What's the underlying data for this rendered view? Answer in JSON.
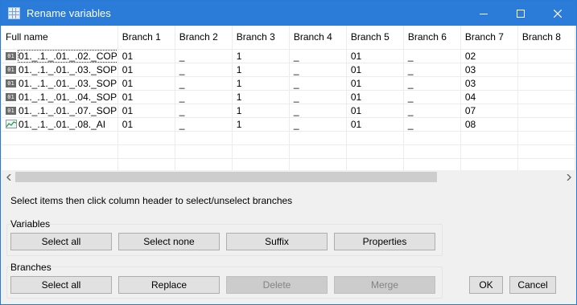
{
  "window": {
    "title": "Rename variables",
    "icon": "grid-icon",
    "controls": [
      "minimize-icon",
      "maximize-icon",
      "close-icon"
    ]
  },
  "grid": {
    "columns": [
      "Full name",
      "Branch 1",
      "Branch 2",
      "Branch 3",
      "Branch 4",
      "Branch 5",
      "Branch 6",
      "Branch 7",
      "Branch 8"
    ],
    "rows": [
      {
        "icon": "variable-icon",
        "name": "01._.1._.01._.02._COP",
        "b1": "01",
        "b2": "_",
        "b3": "1",
        "b4": "_",
        "b5": "01",
        "b6": "_",
        "b7": "02"
      },
      {
        "icon": "variable-icon",
        "name": "01._.1._.01._.03._SOP",
        "b1": "01",
        "b2": "_",
        "b3": "1",
        "b4": "_",
        "b5": "01",
        "b6": "_",
        "b7": "03"
      },
      {
        "icon": "variable-icon",
        "name": "01._.1._.01._.03._SOP",
        "b1": "01",
        "b2": "_",
        "b3": "1",
        "b4": "_",
        "b5": "01",
        "b6": "_",
        "b7": "03"
      },
      {
        "icon": "variable-icon",
        "name": "01._.1._.01._.04._SOP",
        "b1": "01",
        "b2": "_",
        "b3": "1",
        "b4": "_",
        "b5": "01",
        "b6": "_",
        "b7": "04"
      },
      {
        "icon": "variable-icon",
        "name": "01._.1._.01._.07._SOP",
        "b1": "01",
        "b2": "_",
        "b3": "1",
        "b4": "_",
        "b5": "01",
        "b6": "_",
        "b7": "07"
      },
      {
        "icon": "analog-trend-icon",
        "name": "01._.1._.01._.08._AI",
        "b1": "01",
        "b2": "_",
        "b3": "1",
        "b4": "_",
        "b5": "01",
        "b6": "_",
        "b7": "08"
      }
    ]
  },
  "hint": "Select items then click column header to select/unselect branches",
  "variables_group": {
    "label": "Variables",
    "buttons": [
      "Select all",
      "Select none",
      "Suffix",
      "Properties"
    ]
  },
  "branches_group": {
    "label": "Branches",
    "buttons": [
      "Select all",
      "Replace",
      "Delete",
      "Merge"
    ]
  },
  "dialog_buttons": {
    "ok": "OK",
    "cancel": "Cancel"
  }
}
